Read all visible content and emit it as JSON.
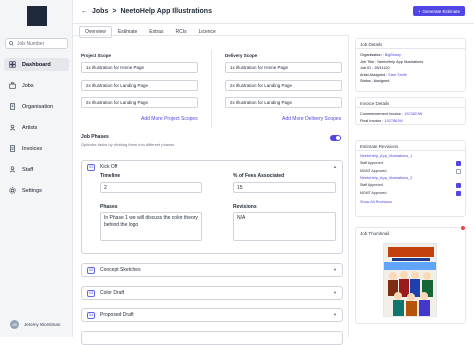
{
  "sidebar": {
    "search_placeholder": "Job Number",
    "items": [
      {
        "label": "Dashboard",
        "icon": "dashboard-icon"
      },
      {
        "label": "Jobs",
        "icon": "briefcase-icon"
      },
      {
        "label": "Organisation",
        "icon": "building-icon"
      },
      {
        "label": "Artists",
        "icon": "users-icon"
      },
      {
        "label": "Invoices",
        "icon": "invoice-icon"
      },
      {
        "label": "Staff",
        "icon": "staff-icon"
      },
      {
        "label": "Settings",
        "icon": "settings-icon"
      }
    ],
    "user": {
      "initials": "JW",
      "name": "Jeremy Worstman"
    }
  },
  "header": {
    "crumb_root": "Jobs",
    "crumb_sep": ">",
    "crumb_title": "NeetoHelp App Illustrations",
    "generate_button": "Generate Estimate",
    "generate_icon": "plus-icon"
  },
  "tabs": [
    "Overview",
    "Estimate",
    "Extras",
    "RCIs",
    "Licence"
  ],
  "project_scope": {
    "title": "Project Scope",
    "items": [
      "1x Illustration for Home Page",
      "2x Illustration for Landing Page",
      "2x Illustration for Landing Page"
    ],
    "add_label": "Add More Project Scopes"
  },
  "delivery_scope": {
    "title": "Delivery Scope",
    "items": [
      "1x Illustration for Home Page",
      "2x Illustration for Landing Page",
      "2x Illustration for Landing Page"
    ],
    "add_label": "Add More Delivery Scopes"
  },
  "job_phases": {
    "title": "Job Phases",
    "subtitle": "Optimize tasks by dividing them into different phases",
    "toggle_on": true,
    "phases": [
      {
        "num": "01",
        "name": "Kick Off"
      },
      {
        "num": "02",
        "name": "Concept Sketches"
      },
      {
        "num": "03",
        "name": "Color Draft"
      },
      {
        "num": "04",
        "name": "Proposed Draft"
      }
    ],
    "kickoff": {
      "timeline_label": "Timeline",
      "timeline_value": "2",
      "fees_label": "% of Fees Associated",
      "fees_value": "15",
      "phases_label": "Phases",
      "phases_value": "In Phase 1 we will discuss the color theory behind the logo",
      "revisions_label": "Revisions",
      "revisions_value": "N/A"
    }
  },
  "job_details": {
    "title": "Job Details",
    "organisation_label": "Organisation :",
    "organisation_value": "BigBinary",
    "job_title_label": "Job Title :",
    "job_title_value": "NeetoHelp App Illustrations",
    "job_id_label": "Job ID :",
    "job_id_value": "JW11120",
    "artist_label": "Artist Assigned :",
    "artist_value": "Sam Smith",
    "status_label": "Status :",
    "status_value": "Assigned"
  },
  "invoice_details": {
    "title": "Invoice Details",
    "commencement_label": "Commencement Invoice :",
    "commencement_value": "192382JW",
    "final_label": "Final Invoice :",
    "final_value": "192786JW"
  },
  "estimate_revisions": {
    "title": "Estimate Revisions",
    "revisions": [
      {
        "name": "NeetoHelp_App_Illustrations_1",
        "rows": [
          {
            "label": "Staff Approved",
            "checked": true
          },
          {
            "label": "MGMT Approved",
            "checked": false
          }
        ]
      },
      {
        "name": "NeetoHelp_App_Illustrations_2",
        "rows": [
          {
            "label": "Staff Approved",
            "checked": true
          },
          {
            "label": "MGMT Approved",
            "checked": true
          }
        ]
      }
    ],
    "show_all": "Show All Revisions"
  },
  "thumbnail": {
    "title": "Job Thumbnail"
  },
  "colors": {
    "accent": "#4f46e5"
  }
}
